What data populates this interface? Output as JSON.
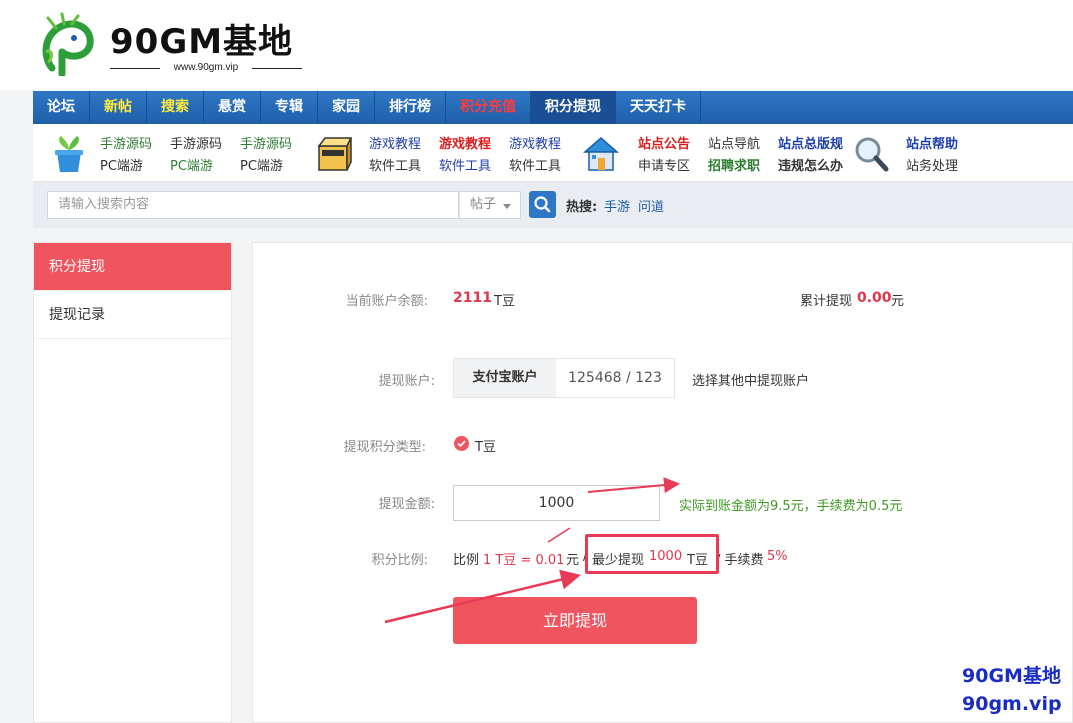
{
  "header": {
    "logo_text": "90GM基地",
    "logo_url": "www.90gm.vip"
  },
  "nav": [
    {
      "label": "论坛",
      "color": "#ffffff"
    },
    {
      "label": "新帖",
      "color": "#ffeb3b"
    },
    {
      "label": "搜索",
      "color": "#ffeb3b"
    },
    {
      "label": "悬赏",
      "color": "#ffffff"
    },
    {
      "label": "专辑",
      "color": "#ffffff"
    },
    {
      "label": "家园",
      "color": "#ffffff"
    },
    {
      "label": "排行榜",
      "color": "#ffffff"
    },
    {
      "label": "积分充值",
      "color": "#ff3b3b"
    },
    {
      "label": "积分提现",
      "color": "#ffffff",
      "active": true
    },
    {
      "label": "天天打卡",
      "color": "#ffffff"
    }
  ],
  "subnav": {
    "g1": [
      "手游源码",
      "手游源码",
      "手游源码",
      "PC端游",
      "PC端游",
      "PC端游"
    ],
    "g2": [
      "游戏教程",
      "游戏教程",
      "游戏教程",
      "软件工具",
      "软件工具",
      "软件工具"
    ],
    "g3": [
      "站点公告",
      "站点导航",
      "站点总版规",
      "申请专区",
      "招聘求职",
      "违规怎么办"
    ],
    "g4": [
      "站点帮助",
      "站务处理"
    ]
  },
  "search": {
    "placeholder": "请输入搜索内容",
    "type": "帖子",
    "hot_label": "热搜:",
    "hot_links": [
      "手游",
      "问道"
    ]
  },
  "sidebar": {
    "items": [
      {
        "label": "积分提现",
        "active": true
      },
      {
        "label": "提现记录",
        "active": false
      }
    ]
  },
  "withdraw": {
    "balance_label": "当前账户余额:",
    "balance_value": "2111",
    "balance_unit": "T豆",
    "total_label": "累计提现",
    "total_value": "0.00",
    "total_unit": "元",
    "account_label": "提现账户:",
    "account_name": "支付宝账户",
    "account_number": "125468 / 123",
    "account_other": "选择其他中提现账户",
    "type_label": "提现积分类型:",
    "type_value": "T豆",
    "amount_label": "提现金额:",
    "amount_value": "1000",
    "amount_hint": "实际到账金额为9.5元，手续费为0.5元",
    "ratio_label": "积分比例:",
    "ratio_prefix": "比例",
    "ratio_value": "1 T豆 = 0.01",
    "ratio_unit": "元",
    "sep": "/",
    "min_prefix": "最少提现",
    "min_value": "1000",
    "min_unit": "T豆",
    "fee_prefix": "/ 手续费",
    "fee_value": "5%",
    "submit_label": "立即提现"
  },
  "watermark": {
    "line1": "90GM基地",
    "line2": "90gm.vip"
  },
  "colors": {
    "accent": "#f0545e",
    "nav_blue": "#2f77c6",
    "hint_green": "#3f9a24",
    "annotation": "#e83a54"
  }
}
